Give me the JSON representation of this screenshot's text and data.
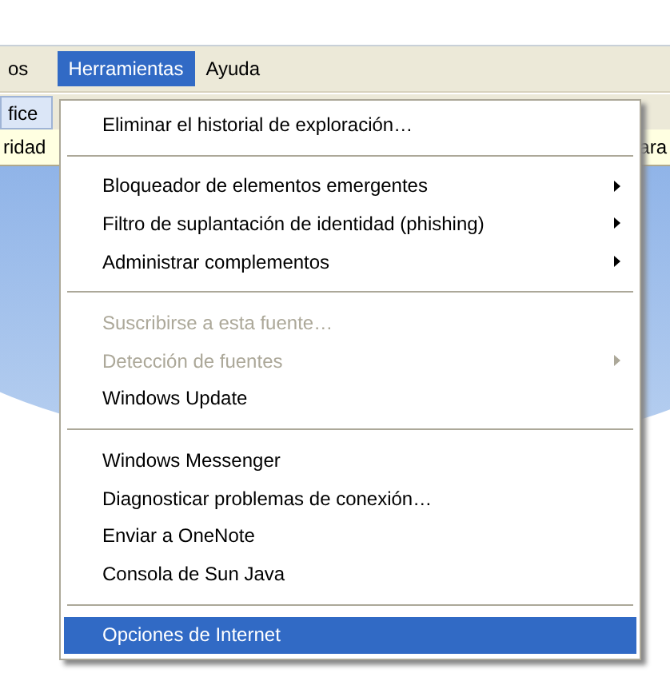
{
  "menubar": [
    {
      "label": "os",
      "selected": false
    },
    {
      "label": "Herramientas",
      "selected": true
    },
    {
      "label": "Ayuda",
      "selected": false
    }
  ],
  "background": {
    "toolbar_tab": "fice",
    "info_bar_left": "ridad",
    "info_bar_right": "ara"
  },
  "menu": [
    {
      "kind": "item",
      "label": "Eliminar el historial de exploración…",
      "disabled": false,
      "submenu": false,
      "selected": false
    },
    {
      "kind": "separator"
    },
    {
      "kind": "item",
      "label": "Bloqueador de elementos emergentes",
      "disabled": false,
      "submenu": true,
      "selected": false
    },
    {
      "kind": "item",
      "label": "Filtro de suplantación de identidad (phishing)",
      "disabled": false,
      "submenu": true,
      "selected": false
    },
    {
      "kind": "item",
      "label": "Administrar complementos",
      "disabled": false,
      "submenu": true,
      "selected": false
    },
    {
      "kind": "separator"
    },
    {
      "kind": "item",
      "label": "Suscribirse a esta fuente…",
      "disabled": true,
      "submenu": false,
      "selected": false
    },
    {
      "kind": "item",
      "label": "Detección de fuentes",
      "disabled": true,
      "submenu": true,
      "selected": false
    },
    {
      "kind": "item",
      "label": "Windows Update",
      "disabled": false,
      "submenu": false,
      "selected": false
    },
    {
      "kind": "separator"
    },
    {
      "kind": "item",
      "label": "Windows Messenger",
      "disabled": false,
      "submenu": false,
      "selected": false
    },
    {
      "kind": "item",
      "label": "Diagnosticar problemas de conexión…",
      "disabled": false,
      "submenu": false,
      "selected": false
    },
    {
      "kind": "item",
      "label": "Enviar a OneNote",
      "disabled": false,
      "submenu": false,
      "selected": false
    },
    {
      "kind": "item",
      "label": "Consola de Sun Java",
      "disabled": false,
      "submenu": false,
      "selected": false
    },
    {
      "kind": "separator"
    },
    {
      "kind": "item",
      "label": "Opciones de Internet",
      "disabled": false,
      "submenu": false,
      "selected": true
    }
  ]
}
